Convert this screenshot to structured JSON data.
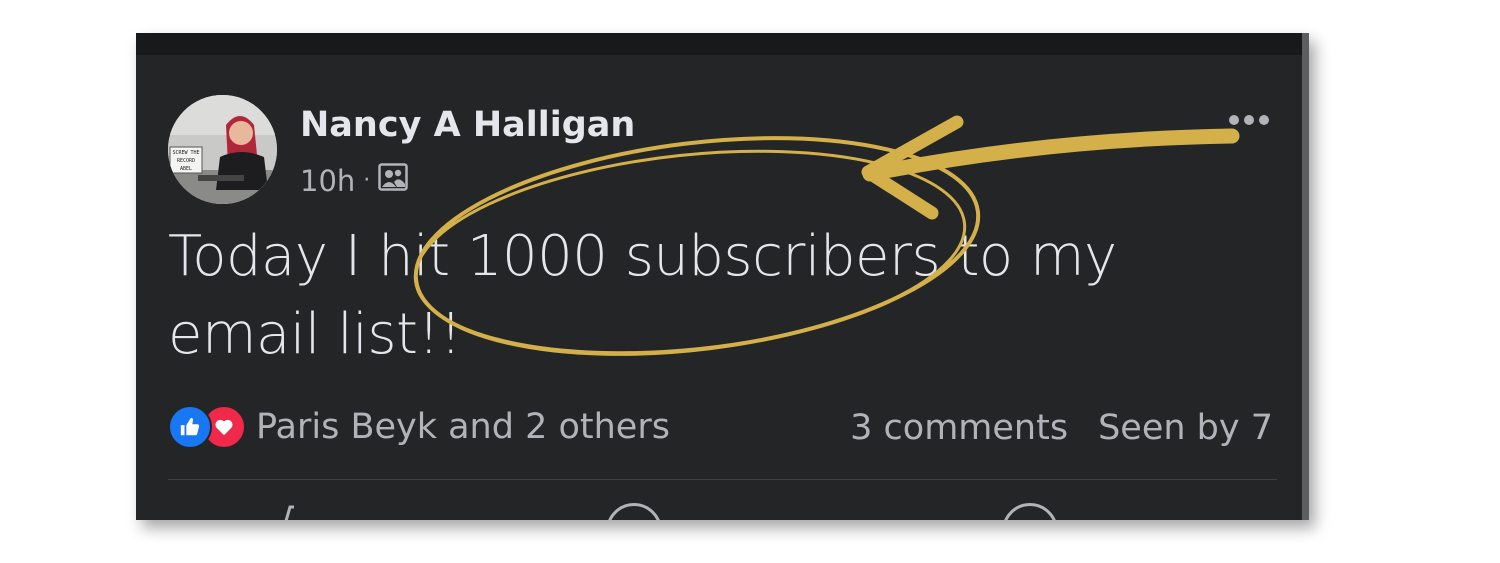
{
  "post": {
    "author": "Nancy A Halligan",
    "time": "10h",
    "separator": "·",
    "audience_icon": "friends-icon",
    "text": "Today I hit 1000 subscribers to my email list!!",
    "reactions_text": "Paris Beyk and 2 others",
    "comments": "3 comments",
    "seen_by": "Seen by 7"
  },
  "avatar_sign": [
    "SCREW THE",
    "RECORD",
    "ABEL"
  ],
  "colors": {
    "card_bg": "#242526",
    "text_primary": "#e4e6eb",
    "text_secondary": "#b0b3b8",
    "like_blue": "#1877f2",
    "love_red": "#f0284a",
    "annotation_gold": "#d4b04a"
  }
}
